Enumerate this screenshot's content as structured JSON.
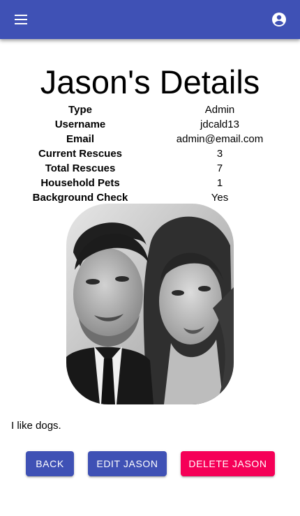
{
  "header": {
    "menu_icon": "hamburger-menu-icon",
    "account_icon": "account-circle-icon",
    "color": "#3f51b5"
  },
  "page_title": "Jason's Details",
  "details": [
    {
      "label": "Type",
      "value": "Admin"
    },
    {
      "label": "Username",
      "value": "jdcald13"
    },
    {
      "label": "Email",
      "value": "admin@email.com"
    },
    {
      "label": "Current Rescues",
      "value": "3"
    },
    {
      "label": "Total Rescues",
      "value": "7"
    },
    {
      "label": "Household Pets",
      "value": "1"
    },
    {
      "label": "Background Check",
      "value": "Yes"
    }
  ],
  "bio": "I like dogs.",
  "buttons": {
    "back": "BACK",
    "edit": "EDIT JASON",
    "delete": "DELETE JASON"
  },
  "colors": {
    "primary": "#3f51b5",
    "secondary": "#f50057"
  }
}
